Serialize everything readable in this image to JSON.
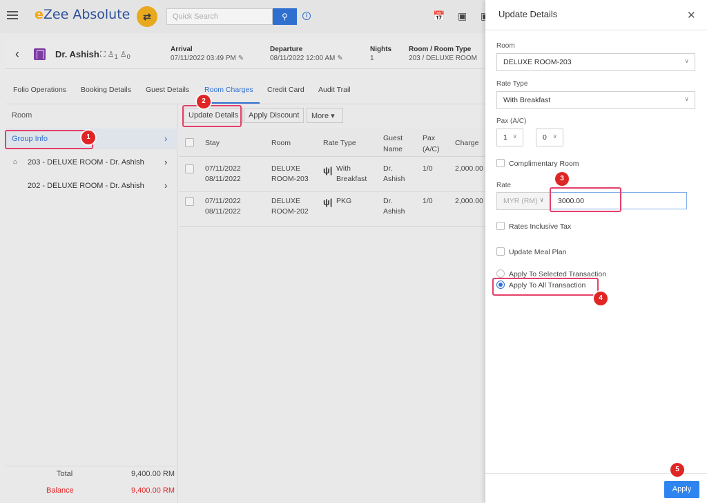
{
  "topbar": {
    "app_name_initial": "e",
    "app_name_rest": "Zee Absolute",
    "search_placeholder": "Quick Search",
    "search_icon": "search-icon",
    "shuffle_icon": "shuffle-icon",
    "info_icon": "info-icon"
  },
  "guest": {
    "name": "Dr. Ashish",
    "pax_adults": "1",
    "pax_children": "0",
    "arrival_label": "Arrival",
    "arrival_value": "07/11/2022 03:49 PM",
    "departure_label": "Departure",
    "departure_value": "08/11/2022 12:00 AM",
    "nights_label": "Nights",
    "nights_value": "1",
    "room_type_label": "Room / Room Type",
    "room_type_value": "203 / DELUXE ROOM"
  },
  "tabs": [
    {
      "label": "Folio Operations"
    },
    {
      "label": "Booking Details"
    },
    {
      "label": "Guest Details"
    },
    {
      "label": "Room Charges"
    },
    {
      "label": "Credit Card"
    },
    {
      "label": "Audit Trail"
    }
  ],
  "left": {
    "header": "Room",
    "group_info": "Group Info",
    "rooms": [
      {
        "label": "203 - DELUXE ROOM - Dr. Ashish"
      },
      {
        "label": "202 - DELUXE ROOM - Dr. Ashish"
      }
    ],
    "total_label": "Total",
    "total_value": "9,400.00 RM",
    "balance_label": "Balance",
    "balance_value": "9,400.00 RM"
  },
  "toolbar": {
    "update_details": "Update Details",
    "apply_discount": "Apply Discount",
    "more": "More"
  },
  "table": {
    "headers": {
      "stay": "Stay",
      "room": "Room",
      "rate_type": "Rate Type",
      "guest_name_1": "Guest",
      "guest_name_2": "Name",
      "pax_1": "Pax",
      "pax_2": "(A/C)",
      "charge": "Charge"
    },
    "rows": [
      {
        "stay_from": "07/11/2022",
        "stay_to": "08/11/2022",
        "room_1": "DELUXE",
        "room_2": "ROOM-203",
        "rate_1": "With",
        "rate_2": "Breakfast",
        "guest_1": "Dr.",
        "guest_2": "Ashish",
        "pax": "1/0",
        "charge": "2,000.00"
      },
      {
        "stay_from": "07/11/2022",
        "stay_to": "08/11/2022",
        "room_1": "DELUXE",
        "room_2": "ROOM-202",
        "rate_1": "PKG",
        "rate_2": "",
        "guest_1": "Dr.",
        "guest_2": "Ashish",
        "pax": "1/0",
        "charge": "2,000.00"
      }
    ]
  },
  "drawer": {
    "title": "Update Details",
    "room_label": "Room",
    "room_value": "DELUXE ROOM-203",
    "rate_type_label": "Rate Type",
    "rate_type_value": "With Breakfast",
    "pax_label": "Pax (A/C)",
    "pax_adult": "1",
    "pax_child": "0",
    "complimentary_label": "Complimentary Room",
    "rate_label": "Rate",
    "currency_value": "MYR (RM)",
    "rate_value": "3000.00",
    "rates_inclusive_tax": "Rates Inclusive Tax",
    "update_meal_plan": "Update Meal Plan",
    "apply_selected": "Apply To Selected Transaction",
    "apply_all": "Apply To All Transaction",
    "apply_button": "Apply"
  },
  "annotations": {
    "badges": [
      "1",
      "2",
      "3",
      "4",
      "5"
    ],
    "highlight_color": "#e53f6a",
    "badge_color": "#e02525"
  },
  "colors": {
    "accent": "#2f6fd0",
    "balance_red": "#e02525",
    "logo_blue": "#2b4f9a",
    "logo_orange": "#f2a614"
  }
}
